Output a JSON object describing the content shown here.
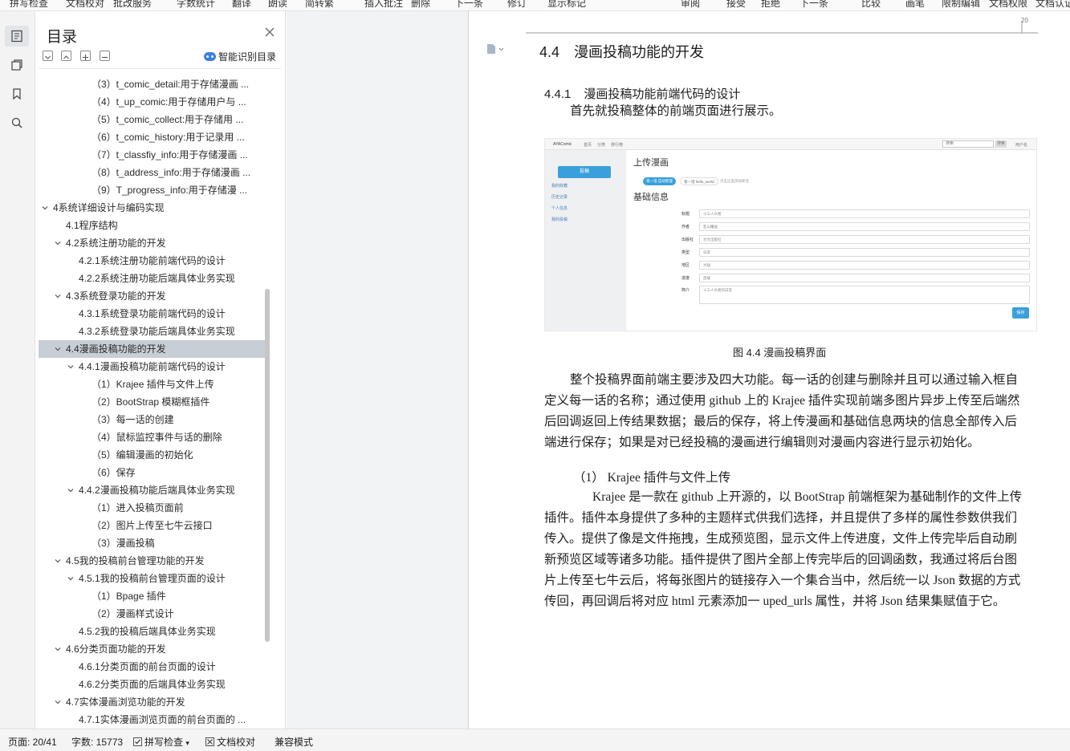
{
  "toolbar": {
    "items": [
      "拼写检查",
      "文档校对",
      "批改服务",
      "字数统计",
      "翻译",
      "朗读",
      "简转繁",
      "插入批注",
      "删除",
      "下一条",
      "修订",
      "显示标记",
      "审阅",
      "接受",
      "拒绝",
      "下一条",
      "比较",
      "画笔",
      "限制编辑",
      "文档权限",
      "文档认证"
    ]
  },
  "rail": {
    "icons": [
      "outline-icon",
      "pages-icon",
      "bookmark-icon",
      "search-icon"
    ]
  },
  "toc": {
    "title": "目录",
    "ai_label": "智能识别目录",
    "items": [
      {
        "text": "（3）t_comic_detail:用于存储漫画 ...",
        "level": 3,
        "caret": false,
        "selected": false
      },
      {
        "text": "（4）t_up_comic:用于存储用户与 ...",
        "level": 3,
        "caret": false,
        "selected": false
      },
      {
        "text": "（5）t_comic_collect:用于存储用 ...",
        "level": 3,
        "caret": false,
        "selected": false
      },
      {
        "text": "（6）t_comic_history:用于记录用 ...",
        "level": 3,
        "caret": false,
        "selected": false
      },
      {
        "text": "（7）t_classfiy_info:用于存储漫画 ...",
        "level": 3,
        "caret": false,
        "selected": false
      },
      {
        "text": "（8）t_address_info:用于存储漫画 ...",
        "level": 3,
        "caret": false,
        "selected": false
      },
      {
        "text": "（9）T_progress_info:用于存储漫 ...",
        "level": 3,
        "caret": false,
        "selected": false
      },
      {
        "text": "4系统详细设计与编码实现",
        "level": 0,
        "caret": true,
        "selected": false
      },
      {
        "text": "4.1程序结构",
        "level": 1,
        "caret": false,
        "selected": false
      },
      {
        "text": "4.2系统注册功能的开发",
        "level": 1,
        "caret": true,
        "selected": false
      },
      {
        "text": "4.2.1系统注册功能前端代码的设计",
        "level": 2,
        "caret": false,
        "selected": false
      },
      {
        "text": "4.2.2系统注册功能后端具体业务实现",
        "level": 2,
        "caret": false,
        "selected": false
      },
      {
        "text": "4.3系统登录功能的开发",
        "level": 1,
        "caret": true,
        "selected": false
      },
      {
        "text": "4.3.1系统登录功能前端代码的设计",
        "level": 2,
        "caret": false,
        "selected": false
      },
      {
        "text": "4.3.2系统登录功能后端具体业务实现",
        "level": 2,
        "caret": false,
        "selected": false
      },
      {
        "text": "4.4漫画投稿功能的开发",
        "level": 1,
        "caret": true,
        "selected": true
      },
      {
        "text": "4.4.1漫画投稿功能前端代码的设计",
        "level": 2,
        "caret": true,
        "selected": false
      },
      {
        "text": "（1）Krajee 插件与文件上传",
        "level": 3,
        "caret": false,
        "selected": false
      },
      {
        "text": "（2）BootStrap 模糊框插件",
        "level": 3,
        "caret": false,
        "selected": false
      },
      {
        "text": "（3）每一话的创建",
        "level": 3,
        "caret": false,
        "selected": false
      },
      {
        "text": "（4）鼠标监控事件与话的删除",
        "level": 3,
        "caret": false,
        "selected": false
      },
      {
        "text": "（5）编辑漫画的初始化",
        "level": 3,
        "caret": false,
        "selected": false
      },
      {
        "text": "（6）保存",
        "level": 3,
        "caret": false,
        "selected": false
      },
      {
        "text": "4.4.2漫画投稿功能后端具体业务实现",
        "level": 2,
        "caret": true,
        "selected": false
      },
      {
        "text": "（1）进入投稿页面前",
        "level": 3,
        "caret": false,
        "selected": false
      },
      {
        "text": "（2）图片上传至七牛云接口",
        "level": 3,
        "caret": false,
        "selected": false
      },
      {
        "text": "（3）漫画投稿",
        "level": 3,
        "caret": false,
        "selected": false
      },
      {
        "text": "4.5我的投稿前台管理功能的开发",
        "level": 1,
        "caret": true,
        "selected": false
      },
      {
        "text": "4.5.1我的投稿前台管理页面的设计",
        "level": 2,
        "caret": true,
        "selected": false
      },
      {
        "text": "（1）Bpage 插件",
        "level": 3,
        "caret": false,
        "selected": false
      },
      {
        "text": "（2）漫画样式设计",
        "level": 3,
        "caret": false,
        "selected": false
      },
      {
        "text": "4.5.2我的投稿后端具体业务实现",
        "level": 2,
        "caret": false,
        "selected": false
      },
      {
        "text": "4.6分类页面功能的开发",
        "level": 1,
        "caret": true,
        "selected": false
      },
      {
        "text": "4.6.1分类页面的前台页面的设计",
        "level": 2,
        "caret": false,
        "selected": false
      },
      {
        "text": "4.6.2分类页面的后端具体业务实现",
        "level": 2,
        "caret": false,
        "selected": false
      },
      {
        "text": "4.7实体漫画浏览功能的开发",
        "level": 1,
        "caret": true,
        "selected": false
      },
      {
        "text": "4.7.1实体漫画浏览页面的前台页面的 ...",
        "level": 2,
        "caret": false,
        "selected": false
      }
    ]
  },
  "doc": {
    "page_top_num": "20",
    "h1_num": "4.4",
    "h1_text": "漫画投稿功能的开发",
    "h2_num": "4.4.1",
    "h2_text": "漫画投稿功能前端代码的设计",
    "intro": "首先就投稿整体的前端页面进行展示。",
    "caption": "图  4.4      漫画投稿界面",
    "p1": [
      "整个投稿界面前端主要涉及四大功能。每一话的创建与删除并且可以通过输入框自",
      "定义每一话的名称；通过使用 github 上的 Krajee 插件实现前端多图片异步上传至后端然",
      "后回调返回上传结果数据；最后的保存，将上传漫画和基础信息两块的信息全部传入后",
      "端进行保存；如果是对已经投稿的漫画进行编辑则对漫画内容进行显示初始化。"
    ],
    "sub": "（1）  Krajee 插件与文件上传",
    "p2": [
      "Krajee 是一款在 github 上开源的，以 BootStrap 前端框架为基础制作的文件上传",
      "插件。插件本身提供了多种的主题样式供我们选择，并且提供了多样的属性参数供我们",
      "传入。提供了像是文件拖拽，生成预览图，显示文件上传进度，文件上传完毕后自动刷",
      "新预览区域等诸多功能。插件提供了图片全部上传完毕后的回调函数，我通过将后台图",
      "片上传至七牛云后，将每张图片的链接存入一个集合当中，然后统一以 Json 数据的方式",
      "传回，再回调后将对应 html 元素添加一 uped_urls 属性，并将 Json 结果集赋值于它。"
    ]
  },
  "figure": {
    "brand": "AYAComic",
    "nav": [
      "首页",
      "分类",
      "排行榜"
    ],
    "search_placeholder": "搜索",
    "search_btn": "搜索",
    "user": "用户名",
    "side_btn": "投稿",
    "side_links": [
      "我的收藏",
      "历史记录",
      "个人信息",
      "我的投稿"
    ],
    "title": "上传漫画",
    "tabs": [
      "第一话 自动管理",
      "第一话 hello_world",
      "点击这里添加新话"
    ],
    "section": "基础信息",
    "fields": [
      {
        "label": "标题",
        "value": "十三人众者"
      },
      {
        "label": "作者",
        "value": "亚山雕画"
      },
      {
        "label": "出版社",
        "value": "文文出版社"
      },
      {
        "label": "类型",
        "value": "日常"
      },
      {
        "label": "地区",
        "value": "大陆"
      },
      {
        "label": "进度",
        "value": "连载"
      },
      {
        "label": "简介",
        "value": "十三人众者的日常"
      }
    ],
    "save": "保存"
  },
  "status": {
    "page": "页面: 20/41",
    "words": "字数: 15773",
    "spell": "拼写检查",
    "proof": "文档校对",
    "compat": "兼容模式"
  }
}
